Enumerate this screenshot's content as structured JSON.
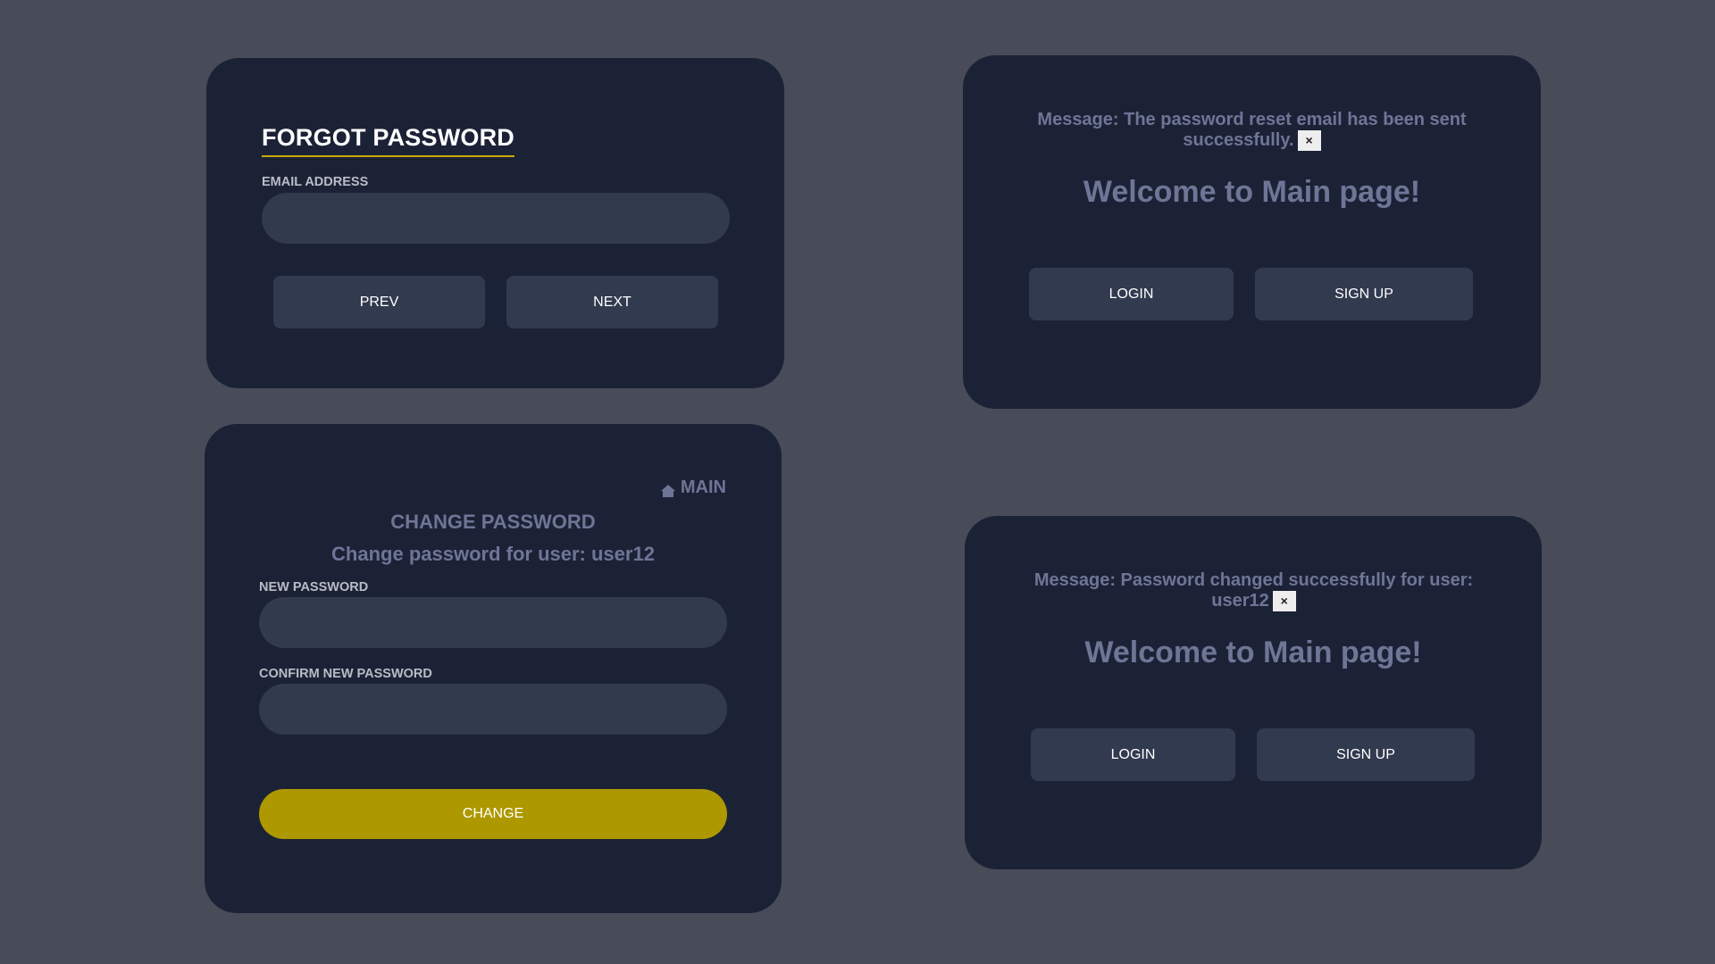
{
  "forgot": {
    "title": "FORGOT PASSWORD",
    "email_label": "EMAIL ADDRESS",
    "email_value": "",
    "prev_label": "PREV",
    "next_label": "NEXT"
  },
  "change": {
    "main_link": "MAIN",
    "title": "CHANGE PASSWORD",
    "subtitle": "Change password for user: user12",
    "new_password_label": "NEW PASSWORD",
    "confirm_label": "CONFIRM NEW PASSWORD",
    "change_label": "CHANGE"
  },
  "main1": {
    "message": "Message: The password reset email has been sent successfully.",
    "close": "×",
    "welcome": "Welcome to Main page!",
    "login_label": "LOGIN",
    "signup_label": "SIGN UP"
  },
  "main2": {
    "message": "Message: Password changed successfully for user: user12",
    "close": "×",
    "welcome": "Welcome to Main page!",
    "login_label": "LOGIN",
    "signup_label": "SIGN UP"
  },
  "colors": {
    "background": "#484b58",
    "card": "#1c2236",
    "input": "#323a4e",
    "accent": "#ae9800",
    "underline": "#c9a90a",
    "muted_text": "#6f7595"
  },
  "icons": {
    "main_link_icon": "home-icon",
    "message_close_icon": "close-icon"
  }
}
